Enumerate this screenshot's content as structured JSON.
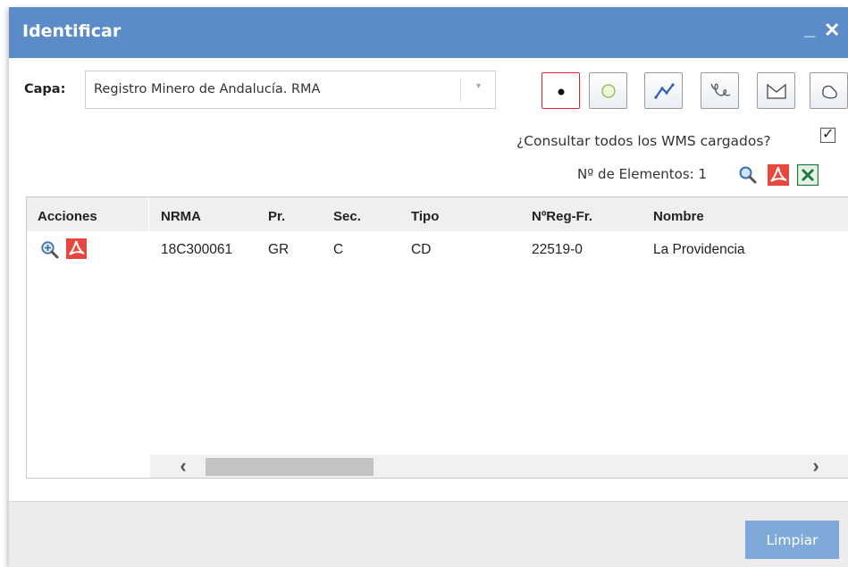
{
  "window": {
    "title": "Identificar",
    "minimize_label": "_",
    "close_label": "✕"
  },
  "layer": {
    "label": "Capa:",
    "selected": "Registro Minero de Andalucía. RMA"
  },
  "tools": [
    {
      "name": "point-tool-icon",
      "active": true
    },
    {
      "name": "circle-tool-icon",
      "active": false
    },
    {
      "name": "polyline-tool-icon",
      "active": false
    },
    {
      "name": "freehand-line-tool-icon",
      "active": false
    },
    {
      "name": "polygon-tool-icon",
      "active": false
    },
    {
      "name": "freehand-polygon-tool-icon",
      "active": false
    }
  ],
  "options": {
    "query_all_wms_label": "¿Consultar todos los WMS cargados?",
    "query_all_wms_checked": true,
    "element_count_label": "Nº de Elementos: 1"
  },
  "table": {
    "columns": [
      "Acciones",
      "NRMA",
      "Pr.",
      "Sec.",
      "Tipo",
      "NºReg-Fr.",
      "Nombre"
    ],
    "rows": [
      {
        "nrma": "18C300061",
        "pr": "GR",
        "sec": "C",
        "tipo": "CD",
        "nreg": "22519-0",
        "nombre": "La Providencia"
      }
    ]
  },
  "footer": {
    "clear_label": "Limpiar"
  },
  "colors": {
    "titlebar": "#5b8bc9",
    "button": "#7fa9d9",
    "pdf": "#e8473f",
    "excel": "#1f7a3a"
  }
}
